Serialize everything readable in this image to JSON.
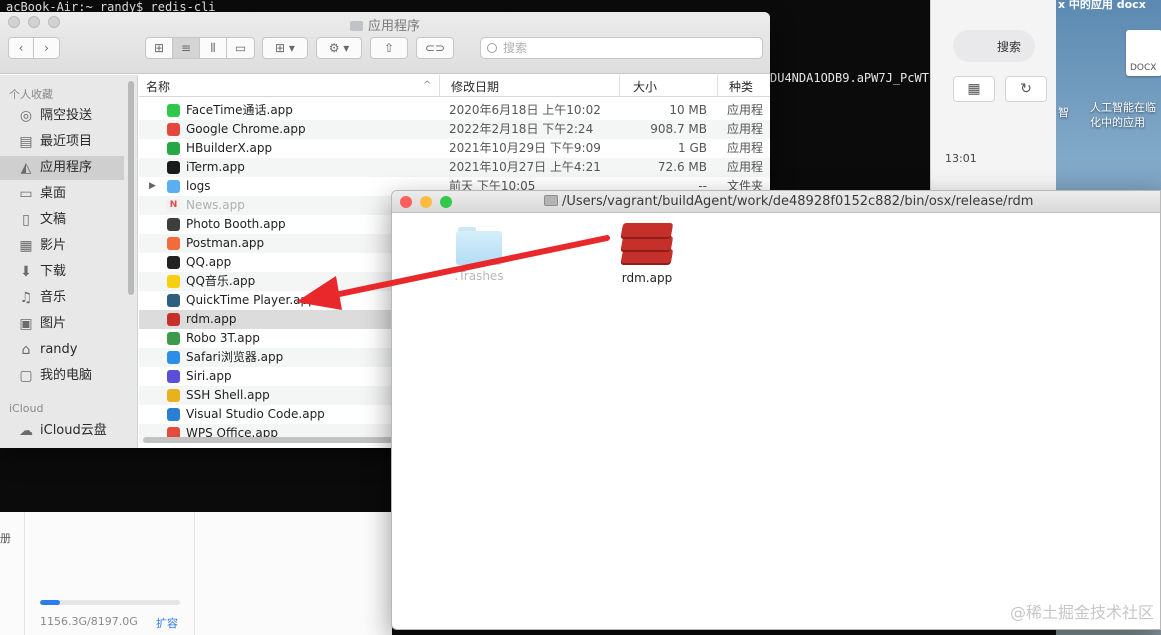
{
  "terminal": {
    "prompt": "acBook-Air:~ randy$ redis-cli",
    "token": "DU4NDA1ODB9.aPW7J_PcWT"
  },
  "browser_bg": {
    "search_label": "搜索",
    "time": "13:01"
  },
  "desktop_right": {
    "top_text": "x  中的应用 docx",
    "doc_label": "DOCX",
    "caption_line1": "人工智能在临",
    "caption_line2": "化中的应用",
    "side_char": "智"
  },
  "storage_panel": {
    "side_label": "册",
    "usage": "1156.3G/8197.0G",
    "expand": "扩容",
    "usage_fraction": 0.141
  },
  "finder": {
    "title": "应用程序",
    "search_placeholder": "搜索",
    "sidebar": {
      "section_favorites": "个人收藏",
      "section_icloud": "iCloud",
      "items": [
        {
          "label": "隔空投送",
          "icon": "airdrop-icon"
        },
        {
          "label": "最近项目",
          "icon": "recents-icon"
        },
        {
          "label": "应用程序",
          "icon": "applications-icon"
        },
        {
          "label": "桌面",
          "icon": "desktop-icon"
        },
        {
          "label": "文稿",
          "icon": "documents-icon"
        },
        {
          "label": "影片",
          "icon": "movies-icon"
        },
        {
          "label": "下载",
          "icon": "downloads-icon"
        },
        {
          "label": "音乐",
          "icon": "music-icon"
        },
        {
          "label": "图片",
          "icon": "pictures-icon"
        },
        {
          "label": "randy",
          "icon": "home-icon"
        },
        {
          "label": "我的电脑",
          "icon": "computer-icon"
        }
      ],
      "icloud_items": [
        {
          "label": "iCloud云盘",
          "icon": "icloud-icon"
        }
      ]
    },
    "columns": {
      "name": "名称",
      "date": "修改日期",
      "size": "大小",
      "kind": "种类"
    },
    "rows": [
      {
        "name": "FaceTime通话.app",
        "date": "2020年6月18日 上午10:02",
        "size": "10 MB",
        "kind": "应用程",
        "color": "#2fc84b"
      },
      {
        "name": "Google Chrome.app",
        "date": "2022年2月18日 下午2:24",
        "size": "908.7 MB",
        "kind": "应用程",
        "color": "#e2483b"
      },
      {
        "name": "HBuilderX.app",
        "date": "2021年10月29日 下午9:09",
        "size": "1 GB",
        "kind": "应用程",
        "color": "#27a745"
      },
      {
        "name": "iTerm.app",
        "date": "2021年10月27日 上午4:21",
        "size": "72.6 MB",
        "kind": "应用程",
        "color": "#1b1b1b"
      },
      {
        "name": "logs",
        "date": "前天 下午10:05",
        "size": "--",
        "kind": "文件夹",
        "color": "#5aaef2"
      },
      {
        "name": "News.app",
        "date": "",
        "size": "",
        "kind": "",
        "color": "#f0f0f0"
      },
      {
        "name": "Photo Booth.app",
        "date": "",
        "size": "",
        "kind": "",
        "color": "#3d3d3d"
      },
      {
        "name": "Postman.app",
        "date": "",
        "size": "",
        "kind": "",
        "color": "#f26b3a"
      },
      {
        "name": "QQ.app",
        "date": "",
        "size": "",
        "kind": "",
        "color": "#222222"
      },
      {
        "name": "QQ音乐.app",
        "date": "",
        "size": "",
        "kind": "",
        "color": "#f6cf13"
      },
      {
        "name": "QuickTime Player.app",
        "date": "",
        "size": "",
        "kind": "",
        "color": "#2f5f80"
      },
      {
        "name": "rdm.app",
        "date": "",
        "size": "",
        "kind": "",
        "color": "#c6302b"
      },
      {
        "name": "Robo 3T.app",
        "date": "",
        "size": "",
        "kind": "",
        "color": "#3c9a4a"
      },
      {
        "name": "Safari浏览器.app",
        "date": "",
        "size": "",
        "kind": "",
        "color": "#2d8ee6"
      },
      {
        "name": "Siri.app",
        "date": "",
        "size": "",
        "kind": "",
        "color": "#5a4fd6"
      },
      {
        "name": "SSH Shell.app",
        "date": "",
        "size": "",
        "kind": "",
        "color": "#e8b21c"
      },
      {
        "name": "Visual Studio Code.app",
        "date": "",
        "size": "",
        "kind": "",
        "color": "#2a7fd3"
      },
      {
        "name": "WPS Office.app",
        "date": "",
        "size": "",
        "kind": "",
        "color": "#e24a3a"
      }
    ]
  },
  "rdm_window": {
    "path": "/Users/vagrant/buildAgent/work/de48928f0152c882/bin/osx/release/rdm",
    "items": [
      {
        "label": ".Trashes"
      },
      {
        "label": "rdm.app"
      }
    ]
  },
  "watermark": "@稀土掘金技术社区",
  "colors": {
    "arrow": "#e8282b",
    "close": "#fc605c",
    "minimize": "#fdbc40",
    "zoom": "#34c84a",
    "accent": "#2b7de9"
  }
}
